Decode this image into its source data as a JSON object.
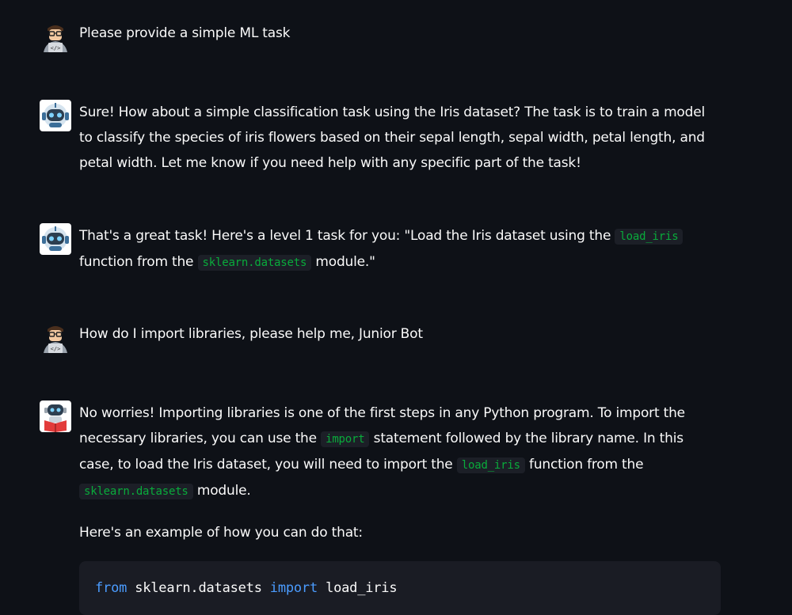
{
  "messages": [
    {
      "role": "user",
      "avatar": "developer-avatar-icon",
      "text": "Please provide a simple ML task"
    },
    {
      "role": "assistant",
      "avatar": "robot-avatar-icon",
      "text": "Sure! How about a simple classification task using the Iris dataset? The task is to train a model to classify the species of iris flowers based on their sepal length, sepal width, petal length, and petal width. Let me know if you need help with any specific part of the task!"
    },
    {
      "role": "assistant",
      "avatar": "robot-avatar-icon",
      "part1": "That's a great task! Here's a level 1 task for you: \"Load the Iris dataset using the ",
      "code1": "load_iris",
      "part2": " function from the ",
      "code2": "sklearn.datasets",
      "part3": " module.\""
    },
    {
      "role": "user",
      "avatar": "developer-avatar-icon",
      "text": "How do I import libraries, please help me, Junior Bot"
    },
    {
      "role": "assistant",
      "avatar": "robot-reading-avatar-icon",
      "part1": "No worries! Importing libraries is one of the first steps in any Python program. To import the necessary libraries, you can use the ",
      "code1": "import",
      "part2": " statement followed by the library name. In this case, to load the Iris dataset, you will need to import the ",
      "code2": "load_iris",
      "part3": " function from the ",
      "code3": "sklearn.datasets",
      "part4": " module.",
      "para2": "Here's an example of how you can do that:",
      "code_block": {
        "kw1": "from",
        "mod": "sklearn.datasets",
        "kw2": "import",
        "name": "load_iris"
      }
    }
  ]
}
